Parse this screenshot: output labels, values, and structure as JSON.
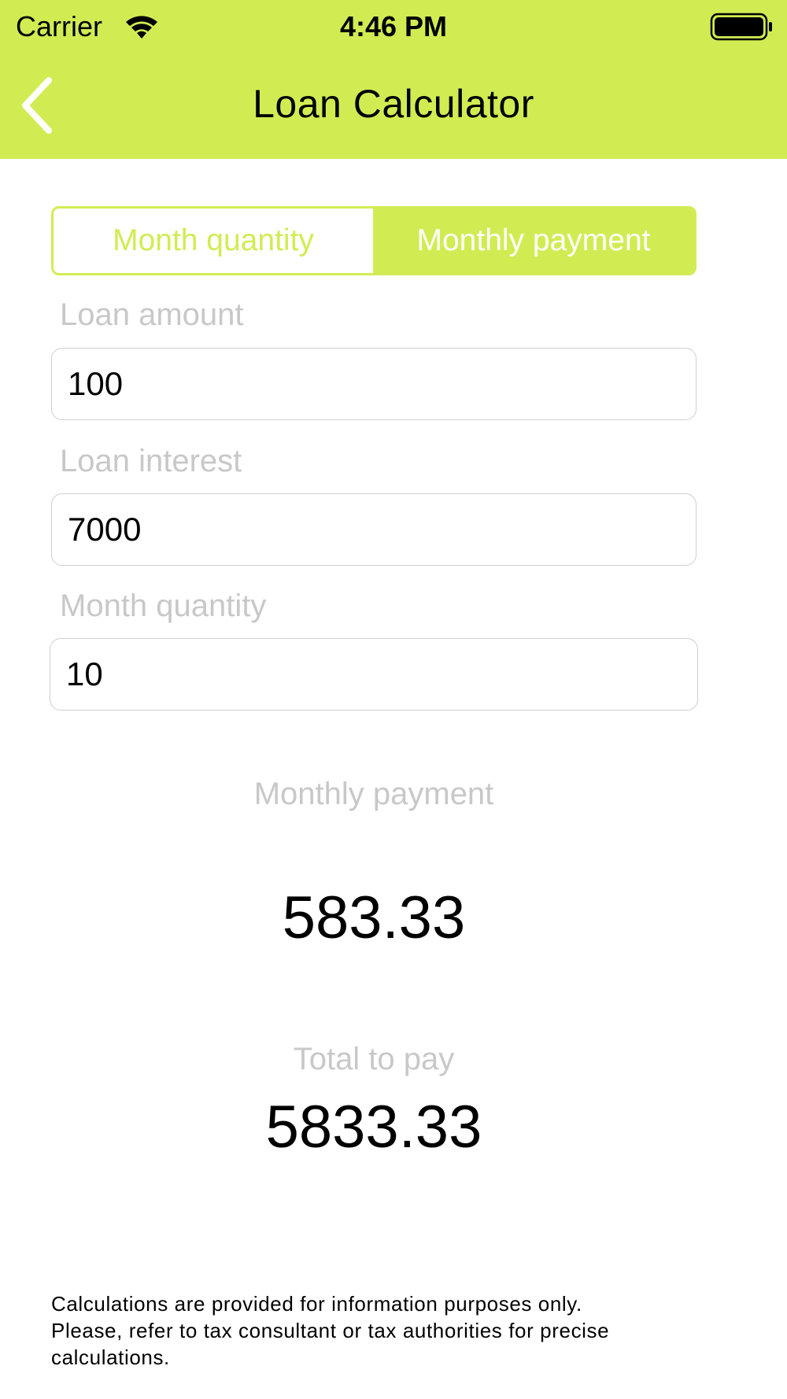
{
  "status_bar": {
    "carrier": "Carrier",
    "time": "4:46 PM",
    "wifi_icon": "wifi-icon",
    "battery_icon": "battery-icon"
  },
  "nav": {
    "title": "Loan Calculator",
    "back_icon": "chevron-left-icon"
  },
  "segmented": {
    "options": [
      "Month quantity",
      "Monthly payment"
    ],
    "selected": "Monthly payment"
  },
  "form": {
    "loan_amount_label": "Loan amount",
    "loan_amount_value": "100",
    "loan_interest_label": "Loan interest",
    "loan_interest_value": "7000",
    "month_quantity_label": "Month quantity",
    "month_quantity_value": "10"
  },
  "results": {
    "monthly_payment_label": "Monthly payment",
    "monthly_payment_value": "583.33",
    "total_label": "Total to pay",
    "total_value": "5833.33"
  },
  "disclaimer": {
    "line1": "Calculations are provided for information purposes only.",
    "line2": "Please, refer to tax consultant or tax authorities for precise",
    "line3": "calculations."
  },
  "colors": {
    "accent": "#d1ec53",
    "label_gray": "#c8c8c8",
    "border_gray": "#cfcfcf"
  }
}
